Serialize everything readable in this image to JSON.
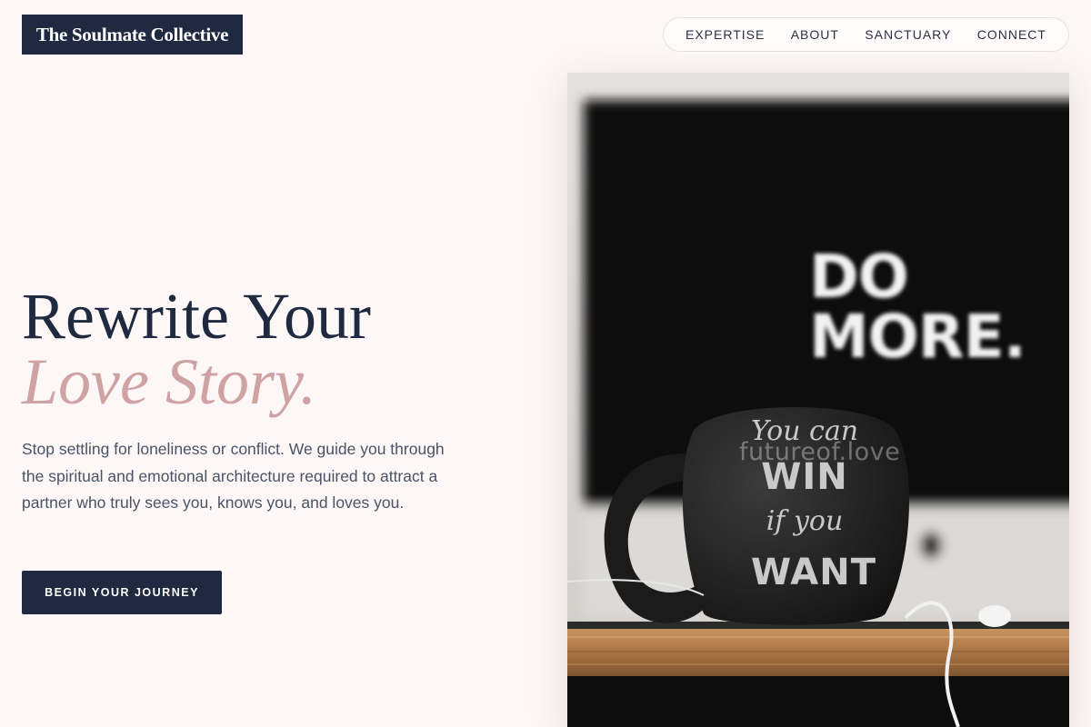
{
  "brand": {
    "name": "The Soulmate Collective"
  },
  "nav": {
    "items": [
      {
        "label": "EXPERTISE"
      },
      {
        "label": "ABOUT"
      },
      {
        "label": "SANCTUARY"
      },
      {
        "label": "CONNECT"
      }
    ]
  },
  "hero": {
    "title_line1": "Rewrite Your",
    "title_line2": "Love Story.",
    "description": "Stop settling for loneliness or conflict. We guide you through the spiritual and emotional architecture required to attract a partner who truly sees you, knows you, and loves you.",
    "cta_label": "BEGIN YOUR JOURNEY"
  },
  "photo": {
    "watermark": "futureof.love",
    "poster_line1": "DO",
    "poster_line2": "MORE.",
    "mug_line1": "You can",
    "mug_line2": "WIN",
    "mug_line3": "if you",
    "mug_line4": "WANT"
  },
  "colors": {
    "background": "#fdf7f7",
    "navy": "#1f2a40",
    "accent_pink": "#cfa3a3",
    "body_text": "#4a5466"
  }
}
